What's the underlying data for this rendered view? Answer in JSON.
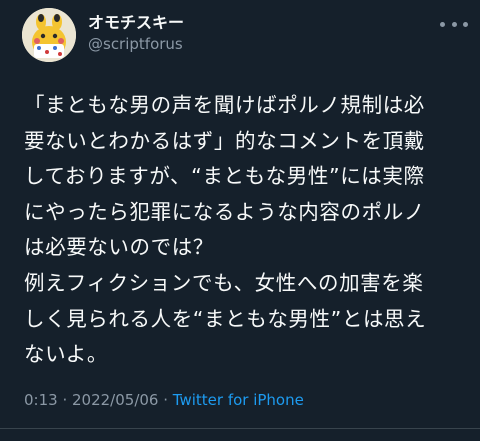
{
  "user": {
    "display_name": "オモチスキー",
    "handle": "@scriptforus"
  },
  "tweet": {
    "lines": [
      "「まともな男の声を聞けばポルノ規制は必",
      "要ないとわかるはず」的なコメントを頂戴",
      "しておりますが、“まともな男性”には実際",
      "にやったら犯罪になるような内容のポルノ",
      "は必要ないのでは？",
      "例えフィクションでも、女性への加害を楽",
      "しく見られる人を“まともな男性”とは思え",
      "ないよ。"
    ]
  },
  "meta": {
    "time": "0:13",
    "separator1": " · ",
    "date": "2022/05/06",
    "separator2": " · ",
    "source": "Twitter for iPhone"
  },
  "icons": {
    "more": "more-icon",
    "avatar": "avatar"
  },
  "colors": {
    "background": "#15202b",
    "accent": "#1d9bf0",
    "secondary_text": "#8b98a5"
  }
}
